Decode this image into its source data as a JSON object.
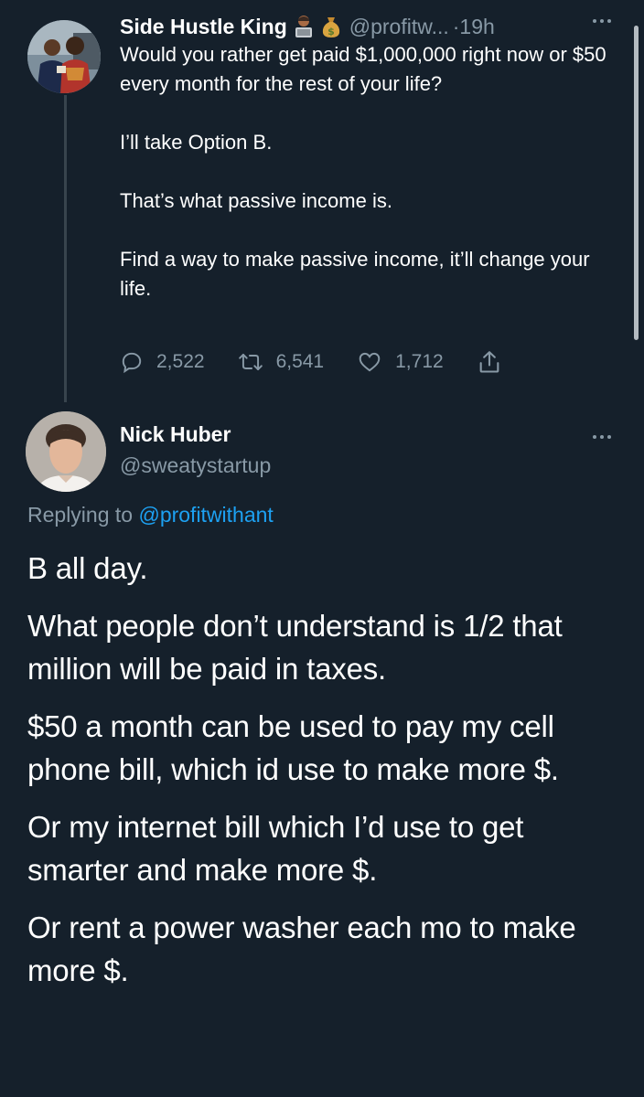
{
  "tweet1": {
    "display_name": "Side Hustle King",
    "emojis": [
      "man-technologist-emoji",
      "money-bag-emoji"
    ],
    "handle": "@profitw...",
    "time": "·19h",
    "paragraphs": [
      "Would you rather get paid $1,000,000 right now or $50 every month for the rest of your life?",
      "I’ll take Option B.",
      "That’s what passive income is.",
      "Find a way to make passive income, it’ll change your life."
    ],
    "stats": {
      "replies": "2,522",
      "retweets": "6,541",
      "likes": "1,712"
    }
  },
  "tweet2": {
    "display_name": "Nick Huber",
    "handle": "@sweatystartup",
    "replying_prefix": "Replying to",
    "replying_to": "@profitwithant",
    "paragraphs": [
      "B all day.",
      "What people don’t understand is 1/2 that million will be paid in taxes.",
      "$50 a month can be used to pay my cell phone bill, which id use to make more $.",
      "Or my internet bill which I’d use to get smarter and make more $.",
      "Or rent a power washer each mo to make more $."
    ]
  },
  "colors": {
    "background": "#15202b",
    "text": "#ffffff",
    "secondary": "#8899a6",
    "link": "#1da1f2",
    "divider": "#38444d"
  },
  "icons": [
    "reply-icon",
    "retweet-icon",
    "like-icon",
    "share-icon",
    "more-icon"
  ]
}
